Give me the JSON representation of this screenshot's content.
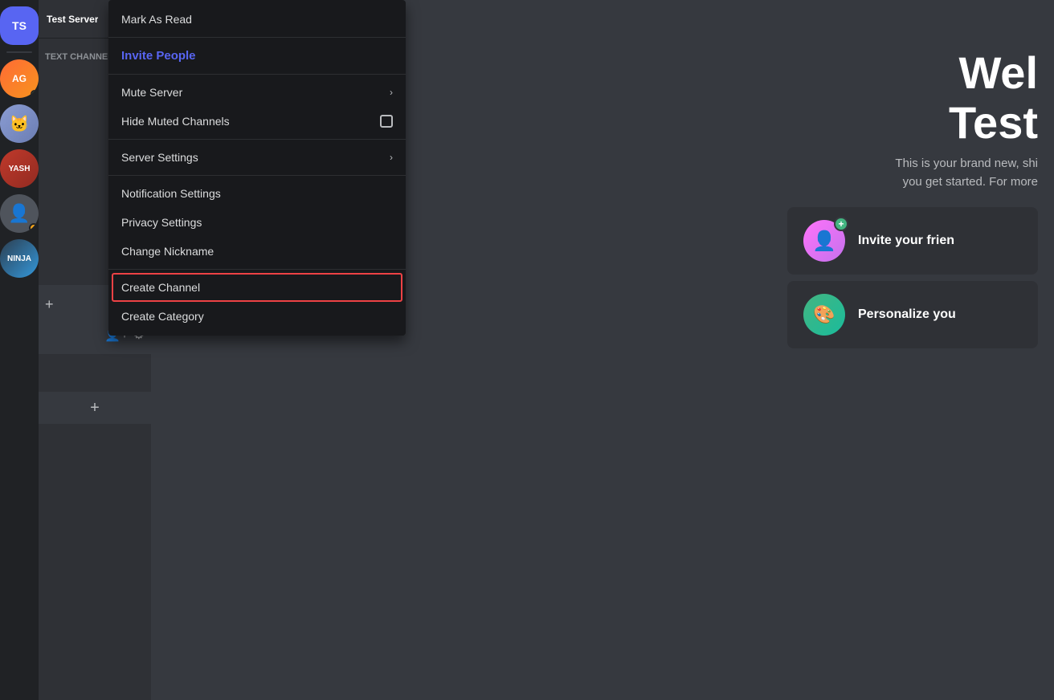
{
  "serverSidebar": {
    "icons": [
      {
        "id": "ts",
        "label": "TS",
        "type": "text",
        "color": "#5865f2"
      },
      {
        "id": "ag",
        "label": "AG",
        "type": "ag"
      },
      {
        "id": "cat",
        "label": "🐱",
        "type": "cat"
      },
      {
        "id": "yash",
        "label": "YASH",
        "type": "yash"
      },
      {
        "id": "person",
        "label": "👤",
        "type": "person"
      },
      {
        "id": "ninja",
        "label": "NINJA",
        "type": "ninja"
      }
    ]
  },
  "contextMenu": {
    "items": [
      {
        "id": "mark-as-read",
        "label": "Mark As Read",
        "type": "normal",
        "dividerAfter": true
      },
      {
        "id": "invite-people",
        "label": "Invite People",
        "type": "invite",
        "dividerAfter": true
      },
      {
        "id": "mute-server",
        "label": "Mute Server",
        "type": "submenu",
        "dividerAfter": false
      },
      {
        "id": "hide-muted-channels",
        "label": "Hide Muted Channels",
        "type": "checkbox",
        "dividerAfter": true
      },
      {
        "id": "server-settings",
        "label": "Server Settings",
        "type": "submenu",
        "dividerAfter": true
      },
      {
        "id": "notification-settings",
        "label": "Notification Settings",
        "type": "normal",
        "dividerAfter": false
      },
      {
        "id": "privacy-settings",
        "label": "Privacy Settings",
        "type": "normal",
        "dividerAfter": false
      },
      {
        "id": "change-nickname",
        "label": "Change Nickname",
        "type": "normal",
        "dividerAfter": true
      },
      {
        "id": "create-channel",
        "label": "Create Channel",
        "type": "highlighted",
        "dividerAfter": false
      },
      {
        "id": "create-category",
        "label": "Create Category",
        "type": "normal",
        "dividerAfter": false
      }
    ]
  },
  "mainContent": {
    "welcomeTitle1": "Wel",
    "welcomeTitle2": "Test",
    "welcomeSubtitle1": "This is your brand new, shi",
    "welcomeSubtitle2": "you get started. For more",
    "actions": [
      {
        "id": "invite-friends",
        "label": "Invite your frien",
        "iconType": "pink"
      },
      {
        "id": "personalize",
        "label": "Personalize you",
        "iconType": "teal"
      }
    ]
  },
  "moveIcon": "✕",
  "channelPlus1Label": "+",
  "channelPlus2Label": "+",
  "addMemberLabel": "👤+",
  "settingsLabel": "⚙"
}
